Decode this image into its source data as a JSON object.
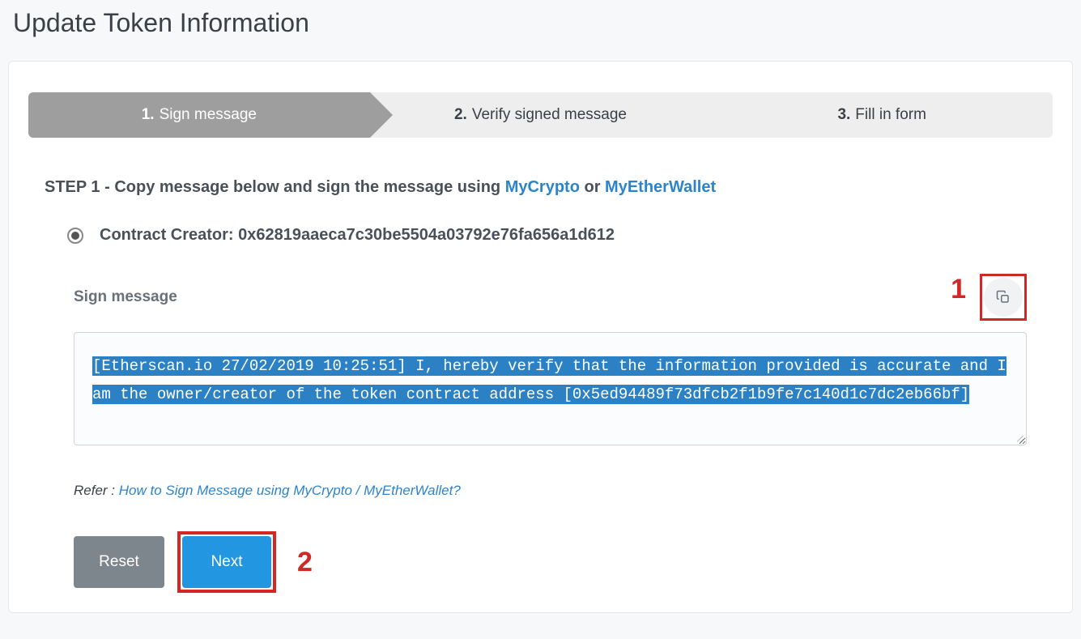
{
  "page_title": "Update Token Information",
  "stepper": {
    "steps": [
      {
        "num": "1.",
        "label": "Sign message"
      },
      {
        "num": "2.",
        "label": "Verify signed message"
      },
      {
        "num": "3.",
        "label": "Fill in form"
      }
    ]
  },
  "instruction": {
    "prefix": "STEP 1 - Copy message below and sign the message using ",
    "link1": "MyCrypto",
    "or": " or ",
    "link2": "MyEtherWallet"
  },
  "radio": {
    "label_prefix": "Contract Creator: ",
    "address": "0x62819aaeca7c30be5504a03792e76fa656a1d612"
  },
  "sign": {
    "label": "Sign message",
    "message": "[Etherscan.io 27/02/2019 10:25:51] I, hereby verify that the information provided is accurate and I am the owner/creator of the token contract address [0x5ed94489f73dfcb2f1b9fe7c140d1c7dc2eb66bf]"
  },
  "refer": {
    "prefix": "Refer : ",
    "link": "How to Sign Message using MyCrypto / MyEtherWallet?"
  },
  "buttons": {
    "reset": "Reset",
    "next": "Next"
  },
  "annotations": {
    "one": "1",
    "two": "2"
  }
}
